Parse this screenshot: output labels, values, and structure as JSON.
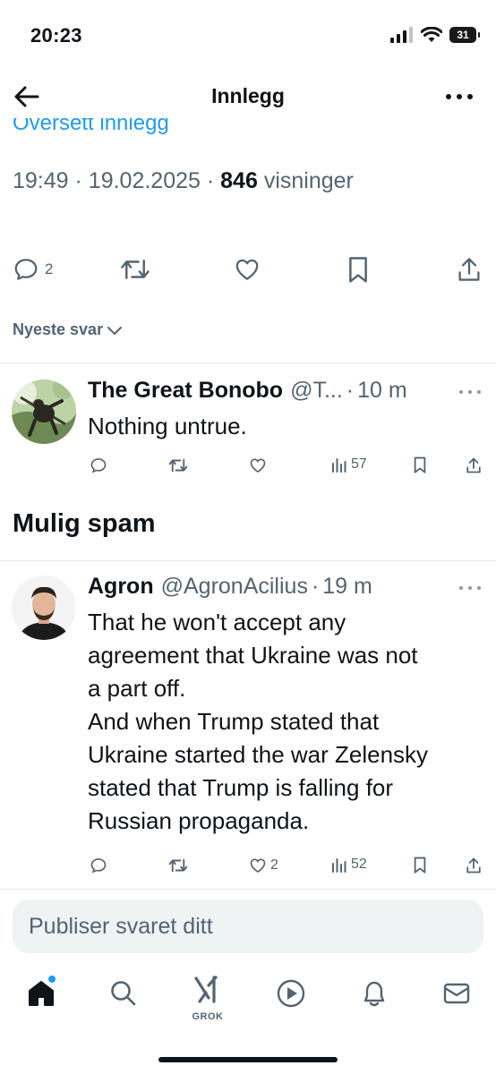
{
  "status_bar": {
    "time": "20:23",
    "battery": "31"
  },
  "header": {
    "title": "Innlegg"
  },
  "post": {
    "translate_link": "Oversett innlegg",
    "time": "19:49",
    "date": "19.02.2025",
    "views_count": "846",
    "views_label": "visninger",
    "reply_count": "2"
  },
  "sort": {
    "label": "Nyeste svar"
  },
  "replies": [
    {
      "name": "The Great Bonobo",
      "handle": "@T...",
      "time": "10 m",
      "text": "Nothing untrue.",
      "views": "57",
      "likes": ""
    },
    {
      "name": "Agron",
      "handle": "@AgronAcilius",
      "time": "19 m",
      "text": "That he won't accept any\nagreement that Ukraine was not\na part off.\nAnd when Trump stated that\nUkraine started the war Zelensky\nstated that Trump is falling for\nRussian propaganda.",
      "views": "52",
      "likes": "2"
    }
  ],
  "spam_section": {
    "title": "Mulig spam"
  },
  "compose": {
    "placeholder": "Publiser svaret ditt"
  },
  "tabbar": {
    "grok_label": "GROK"
  },
  "colors": {
    "accent": "#1d9bf0",
    "secondary_text": "#536471",
    "primary_text": "#0f1419"
  }
}
